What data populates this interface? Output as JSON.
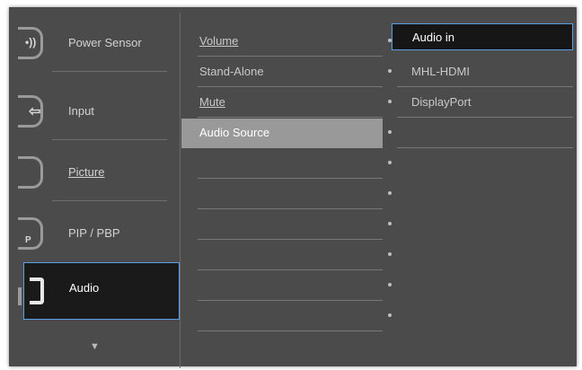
{
  "sidebar": {
    "items": [
      {
        "label": "Power Sensor",
        "icon": "power-sensor-icon"
      },
      {
        "label": "Input",
        "icon": "input-icon"
      },
      {
        "label": "Picture",
        "icon": "picture-icon"
      },
      {
        "label": "PIP / PBP",
        "icon": "pip-pbp-icon"
      },
      {
        "label": "Audio",
        "icon": "audio-icon"
      }
    ],
    "scroll_down": "▼"
  },
  "submenu": {
    "items": [
      {
        "label": "Volume"
      },
      {
        "label": "Stand-Alone"
      },
      {
        "label": "Mute"
      },
      {
        "label": "Audio Source"
      }
    ]
  },
  "options": {
    "items": [
      {
        "label": "Audio in"
      },
      {
        "label": "MHL-HDMI"
      },
      {
        "label": "DisplayPort"
      }
    ]
  },
  "colors": {
    "panel": "#4b4b4b",
    "accent": "#5aa0e6",
    "selected_row": "#999999"
  }
}
